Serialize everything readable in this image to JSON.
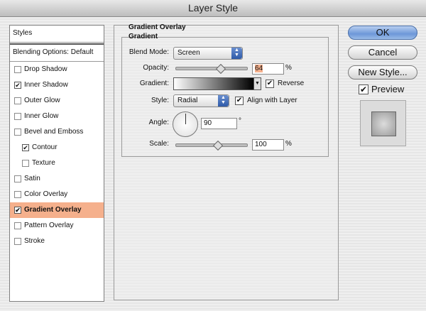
{
  "window": {
    "title": "Layer Style"
  },
  "styles_list": {
    "header": "Styles",
    "blending_options": "Blending Options: Default",
    "items": [
      {
        "label": "Drop Shadow",
        "checked": false,
        "sub": false,
        "selected": false
      },
      {
        "label": "Inner Shadow",
        "checked": true,
        "sub": false,
        "selected": false
      },
      {
        "label": "Outer Glow",
        "checked": false,
        "sub": false,
        "selected": false
      },
      {
        "label": "Inner Glow",
        "checked": false,
        "sub": false,
        "selected": false
      },
      {
        "label": "Bevel and Emboss",
        "checked": false,
        "sub": false,
        "selected": false
      },
      {
        "label": "Contour",
        "checked": true,
        "sub": true,
        "selected": false
      },
      {
        "label": "Texture",
        "checked": false,
        "sub": true,
        "selected": false
      },
      {
        "label": "Satin",
        "checked": false,
        "sub": false,
        "selected": false
      },
      {
        "label": "Color Overlay",
        "checked": false,
        "sub": false,
        "selected": false
      },
      {
        "label": "Gradient Overlay",
        "checked": true,
        "sub": false,
        "selected": true
      },
      {
        "label": "Pattern Overlay",
        "checked": false,
        "sub": false,
        "selected": false
      },
      {
        "label": "Stroke",
        "checked": false,
        "sub": false,
        "selected": false
      }
    ]
  },
  "panel": {
    "title": "Gradient Overlay",
    "section": "Gradient",
    "blend_mode_label": "Blend Mode:",
    "blend_mode_value": "Screen",
    "opacity_label": "Opacity:",
    "opacity_value": "64",
    "opacity_fraction": 0.64,
    "percent": "%",
    "gradient_label": "Gradient:",
    "reverse_label": "Reverse",
    "reverse_checked": true,
    "style_label": "Style:",
    "style_value": "Radial",
    "align_label": "Align with Layer",
    "align_checked": true,
    "angle_label": "Angle:",
    "angle_value": "90",
    "degree": "°",
    "scale_label": "Scale:",
    "scale_value": "100",
    "scale_fraction": 0.6
  },
  "buttons": {
    "ok": "OK",
    "cancel": "Cancel",
    "new_style": "New Style...",
    "preview_label": "Preview",
    "preview_checked": true
  },
  "colors": {
    "selection": "#f5b08c",
    "default_button": "#6d97d8"
  }
}
